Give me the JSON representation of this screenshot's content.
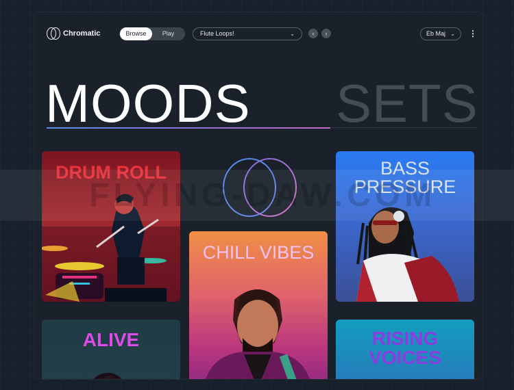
{
  "toolbar": {
    "app_name": "Chromatic",
    "browse_label": "Browse",
    "play_label": "Play",
    "preset_value": "Flute Loops!",
    "prev_icon": "chevron-left-icon",
    "next_icon": "chevron-right-icon",
    "key_value": "Eb Maj",
    "more_icon": "vertical-ellipsis-icon"
  },
  "tabs": [
    {
      "label": "MOODS",
      "active": true
    },
    {
      "label": "SETS",
      "active": false
    }
  ],
  "cards": [
    {
      "title": "DRUM ROLL",
      "color": "#e8323d"
    },
    {
      "title": "CHILL VIBES",
      "color": "#f6c3ef"
    },
    {
      "title": "BASS PRESSURE",
      "line1": "BASS",
      "line2": "PRESSURE",
      "color": "#d9e3f2"
    },
    {
      "title": "ALIVE",
      "color": "#e04ae8"
    },
    {
      "title": "RISING VOICES",
      "line1": "RISING",
      "line2": "VOICES",
      "color": "#8a3ee0"
    }
  ],
  "watermark": "FLYING-DAW.COM",
  "colors": {
    "background": "#16212c",
    "panel": "#1a212b",
    "accent_gradient": [
      "#5b8fe6",
      "#c06ac4"
    ],
    "inactive_tab": "#454c56"
  }
}
